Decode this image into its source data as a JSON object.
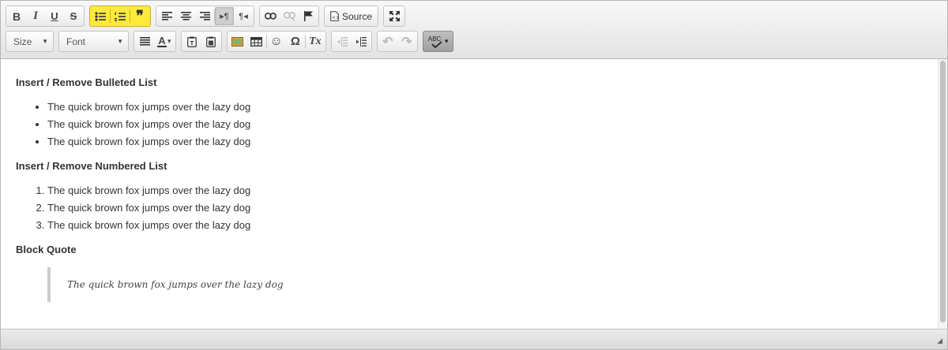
{
  "toolbar": {
    "bold_label": "B",
    "italic_label": "I",
    "underline_label": "U",
    "strike_label": "S",
    "blockquote_icon": "❞",
    "ltr_icon": "▸¶",
    "rtl_icon": "¶◂",
    "source_label": "Source",
    "font_size": {
      "label": "Size",
      "arrow": "▼"
    },
    "font_family": {
      "label": "Font",
      "arrow": "▼"
    },
    "text_color_label": "A",
    "text_color_arrow": "▾",
    "smiley_icon": "☺",
    "omega_icon": "Ω",
    "remove_format_label": "Tx",
    "undo_icon": "↶",
    "redo_icon": "↷",
    "spell_label": "ABC",
    "spell_arrow": "▾"
  },
  "content": {
    "heading_bulleted": "Insert / Remove Bulleted List",
    "bulleted": [
      "The quick brown fox jumps over the lazy dog",
      "The quick brown fox jumps over the lazy dog",
      "The quick brown fox jumps over the lazy dog"
    ],
    "heading_numbered": "Insert / Remove Numbered List",
    "numbered": [
      "The quick brown fox jumps over the lazy dog",
      "The quick brown fox jumps over the lazy dog",
      "The quick brown fox jumps over the lazy dog"
    ],
    "heading_quote": "Block Quote",
    "quote": "The quick brown fox jumps over the lazy dog"
  },
  "statusbar": {
    "resize_icon": "◢"
  }
}
